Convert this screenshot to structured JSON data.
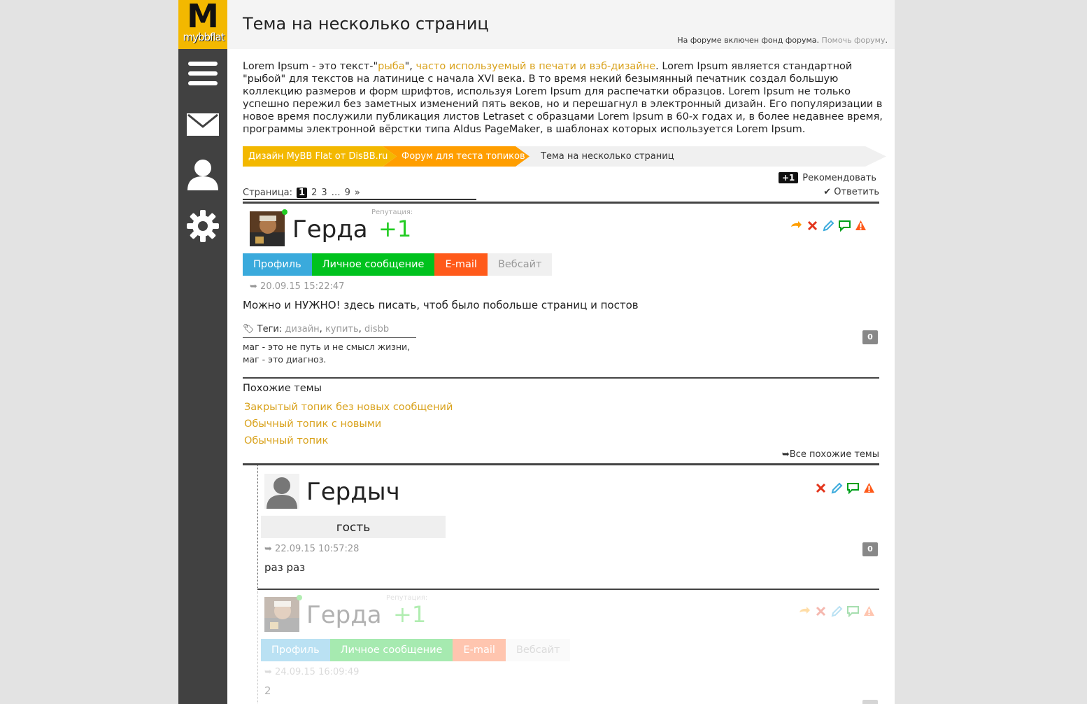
{
  "logo": {
    "big": "M",
    "small": "mybbflat"
  },
  "header": {
    "title": "Тема на несколько страниц",
    "fund_text": "На форуме включен фонд форума.",
    "fund_link": "Помочь форуму"
  },
  "intro": {
    "p1": "Lorem Ipsum - это текст-\"",
    "link1": "рыба",
    "p2": "\", ",
    "link2": "часто используемый в печати и вэб-дизайне",
    "p3": ". Lorem Ipsum является стандартной \"рыбой\" для текстов на латинице с начала XVI века. В то время некий безымянный печатник создал большую коллекцию размеров и форм шрифтов, используя Lorem Ipsum для распечатки образцов. Lorem Ipsum не только успешно пережил без заметных изменений пять веков, но и перешагнул в электронный дизайн. Его популяризации в новое время послужили публикация листов Letraset с образцами Lorem Ipsum в 60-х годах и, в более недавнее время, программы электронной вёрстки типа Aldus PageMaker, в шаблонах которых используется Lorem Ipsum."
  },
  "breadcrumb": [
    "Дизайн MyBB Flat от DisBB.ru",
    "Форум для теста топиков",
    "Тема на несколько страниц"
  ],
  "pager": {
    "label": "Страница:",
    "current": "1",
    "pages": [
      "2",
      "3",
      "…",
      "9",
      "»"
    ]
  },
  "recommend": {
    "badge": "+1",
    "label": "Рекомендовать"
  },
  "reply": "Ответить",
  "posts": [
    {
      "user": "Герда",
      "rep_label": "Репутация:",
      "rep": "+1",
      "buttons": [
        "Профиль",
        "Личное сообщение",
        "E-mail",
        "Вебсайт"
      ],
      "date": "20.09.15 15:22:47",
      "text": "Можно и НУЖНО! здесь писать, чтоб было побольше страниц и постов",
      "badge": "0",
      "tags_label": "Теги:",
      "tags": [
        "дизайн",
        "купить",
        "disbb"
      ],
      "sig1": "маг - это не путь и не смысл жизни,",
      "sig2": "маг - это диагноз."
    },
    {
      "user": "Гердыч",
      "role": "гость",
      "date": "22.09.15 10:57:28",
      "text": "раз раз",
      "badge": "0"
    },
    {
      "user": "Герда",
      "rep_label": "Репутация:",
      "rep": "+1",
      "buttons": [
        "Профиль",
        "Личное сообщение",
        "E-mail",
        "Вебсайт"
      ],
      "date": "24.09.15 16:09:49",
      "text": "2"
    }
  ],
  "similar": {
    "title": "Похожие темы",
    "items": [
      "Закрытый топик без новых сообщений",
      "Обычный топик с новыми",
      "Обычный топик"
    ],
    "all": "Все похожие темы"
  },
  "colors": {
    "accent": "#f3b800",
    "orange": "#ff9e00",
    "green": "#00c21e",
    "blue": "#3aaadc",
    "red": "#ff5a1a"
  }
}
